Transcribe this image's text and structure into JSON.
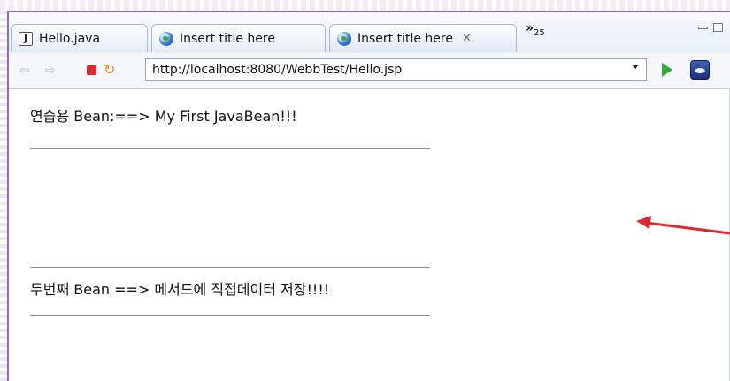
{
  "tabs": [
    {
      "label": "Hello.java",
      "icon": "java-file-icon"
    },
    {
      "label": "Insert title here",
      "icon": "globe-icon"
    },
    {
      "label": "Insert title here",
      "icon": "globe-icon",
      "active": true
    }
  ],
  "overflow": {
    "chevrons": "»",
    "count": "25"
  },
  "toolbar": {
    "url": "http://localhost:8080/WebbTest/Hello.jsp"
  },
  "content": {
    "line1": "연습용 Bean:==> My First JavaBean!!!",
    "line2": "두번째 Bean ==> 메서드에 직접데이터 저장!!!!"
  },
  "colors": {
    "frame": "#8a6fa8",
    "annotation_arrow": "#e0262f",
    "stop": "#e0262f",
    "go": "#3aa83a"
  }
}
